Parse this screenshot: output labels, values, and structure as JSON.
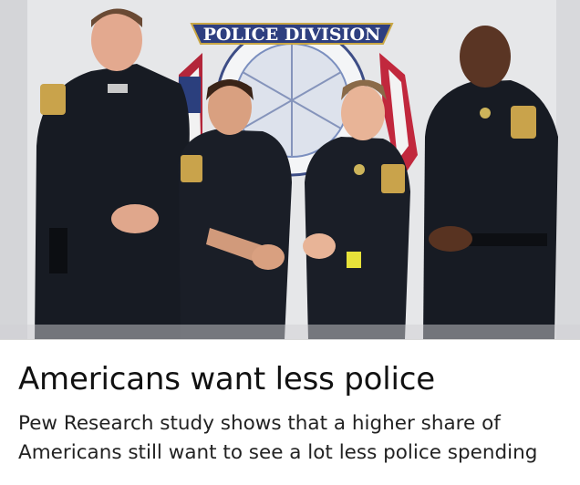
{
  "article": {
    "photo_alt": "",
    "emblem_text": "POLICE DIVISION",
    "headline": "Americans want less police",
    "summary": "Pew Research study shows that a higher share of Americans still want to see a lot less police spending"
  },
  "colors": {
    "uniform": "#161a22",
    "wall": "#e7e8ea",
    "headline": "#111111",
    "summary": "#222222"
  }
}
